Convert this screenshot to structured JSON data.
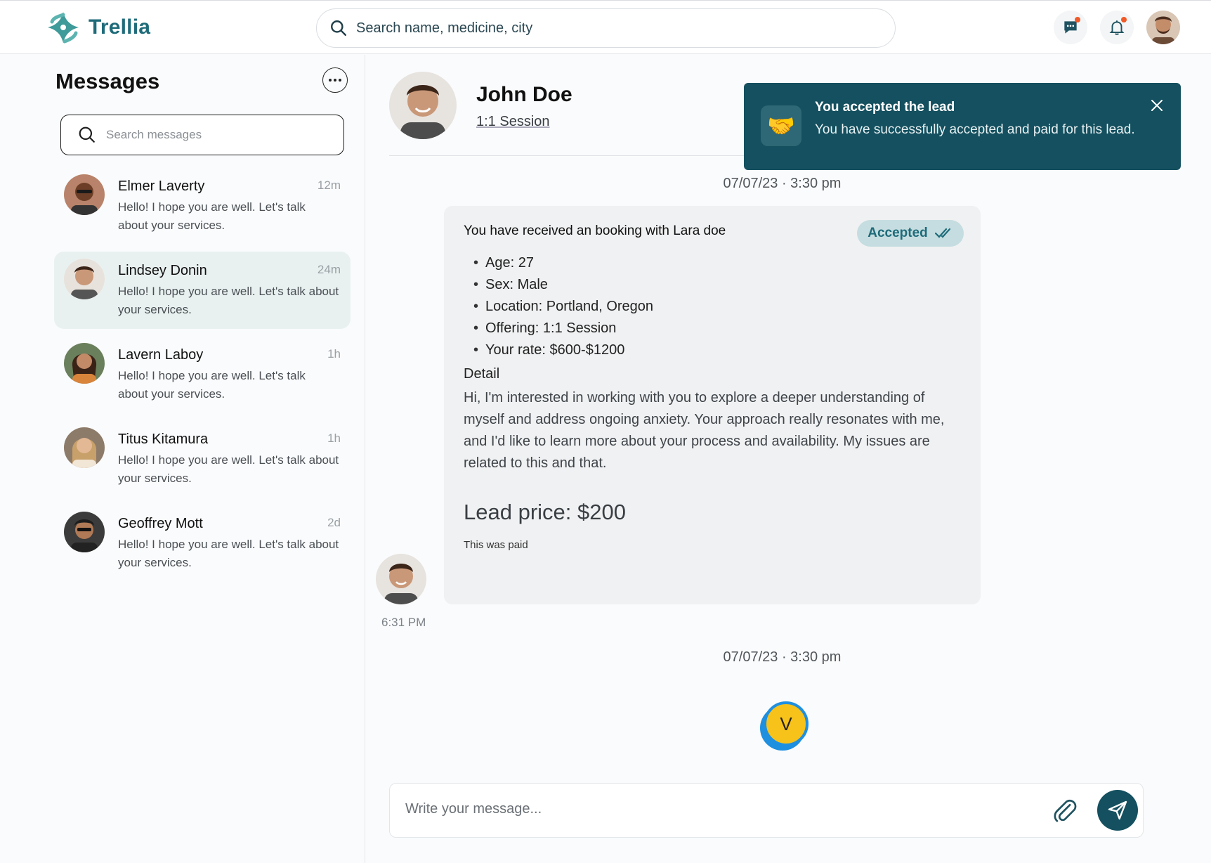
{
  "app": {
    "name": "Trellia",
    "brand_color": "#1f6b7a",
    "toast_color": "#14505f"
  },
  "topbar": {
    "search_placeholder": "Search name, medicine, city",
    "icons": [
      "chat-icon",
      "bell-icon",
      "user-avatar"
    ]
  },
  "sidebar": {
    "title": "Messages",
    "search_placeholder": "Search messages",
    "conversations": [
      {
        "name": "Elmer Laverty",
        "time": "12m",
        "preview": "Hello! I hope you are well. Let's talk about your services.",
        "active": false
      },
      {
        "name": "Lindsey Donin",
        "time": "24m",
        "preview": "Hello! I hope you are well. Let's talk about your services.",
        "active": true
      },
      {
        "name": "Lavern Laboy",
        "time": "1h",
        "preview": "Hello! I hope you are well. Let's talk about your services.",
        "active": false
      },
      {
        "name": "Titus Kitamura",
        "time": "1h",
        "preview": "Hello! I hope you are well. Let's talk about your services.",
        "active": false
      },
      {
        "name": "Geoffrey Mott",
        "time": "2d",
        "preview": "Hello! I hope you are well. Let's talk about your services.",
        "active": false
      }
    ]
  },
  "chat": {
    "contact_name": "John Doe",
    "contact_subtitle": "1:1 Session",
    "date_1": "07/07/23 · 3:30 pm",
    "date_2": "07/07/23 · 3:30 pm",
    "card": {
      "title": "You have received  an booking with Lara doe",
      "status": "Accepted",
      "bullets": [
        "Age: 27",
        "Sex: Male",
        "Location: Portland, Oregon",
        "Offering: 1:1 Session",
        "Your rate: $600-$1200"
      ],
      "detail_heading": "Detail",
      "detail_text": "Hi, I'm interested in working with you to explore a deeper understanding of myself and address ongoing anxiety. Your approach really resonates with me, and I'd like to learn more about your process and availability. My issues are related to this and that.",
      "lead_price": "Lead price: $200",
      "paid_note": "This was paid"
    },
    "sender_time": "6:31 PM",
    "typing_initial": "V",
    "composer_placeholder": "Write your message..."
  },
  "toast": {
    "title": "You accepted the lead",
    "body": "You have successfully accepted and paid for this lead.",
    "icon": "handshake-icon"
  }
}
